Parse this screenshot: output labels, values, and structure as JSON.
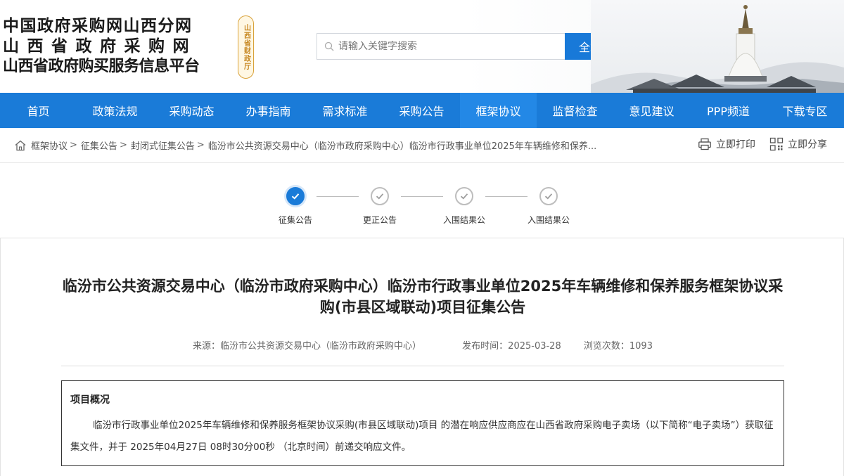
{
  "header": {
    "logo_line1": "中国政府采购网山西分网",
    "logo_line2": "山西省政府采购网",
    "logo_line3": "山西省政府购买服务信息平台",
    "seal_text": "山西省财政厅",
    "search_placeholder": "请输入关键字搜索",
    "search_button": "全站搜索"
  },
  "nav": {
    "items": [
      "首页",
      "政策法规",
      "采购动态",
      "办事指南",
      "需求标准",
      "采购公告",
      "框架协议",
      "监督检查",
      "意见建议",
      "PPP频道",
      "下载专区"
    ],
    "active_index": 6
  },
  "breadcrumb": {
    "items": [
      "框架协议",
      "征集公告",
      "封闭式征集公告"
    ],
    "current": "临汾市公共资源交易中心（临汾市政府采购中心）临汾市行政事业单位2025年车辆维修和保养..."
  },
  "actions": {
    "print": "立即打印",
    "share": "立即分享"
  },
  "steps": {
    "items": [
      "征集公告",
      "更正公告",
      "入围结果公",
      "入围结果公"
    ],
    "active_index": 0
  },
  "article": {
    "title": "临汾市公共资源交易中心（临汾市政府采购中心）临汾市行政事业单位2025年车辆维修和保养服务框架协议采购(市县区域联动)项目征集公告",
    "source": "来源：临汾市公共资源交易中心（临汾市政府采购中心）",
    "publish_time": "发布时间：2025-03-28",
    "views": "浏览次数：1093",
    "overview_title": "项目概况",
    "overview_text": "临汾市行政事业单位2025年车辆维修和保养服务框架协议采购(市县区域联动)项目 的潜在响应供应商应在山西省政府采购电子卖场（以下简称“电子卖场”）获取征集文件，并于 2025年04月27日 08时30分00秒 （北京时间）前递交响应文件。"
  },
  "colors": {
    "primary": "#1a7bd8",
    "nav_active": "#2388e6",
    "seal": "#c6861e"
  }
}
